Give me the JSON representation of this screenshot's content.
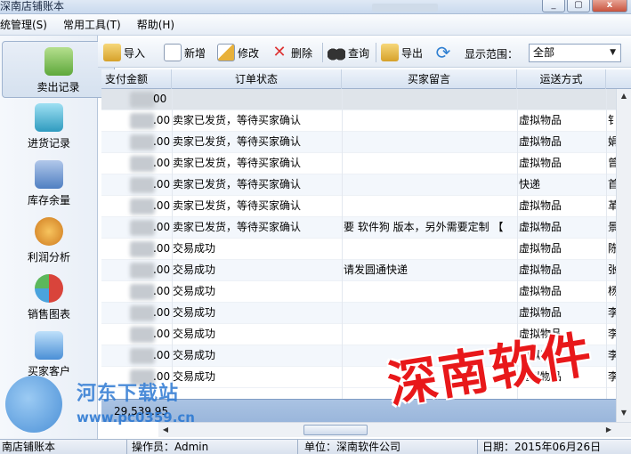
{
  "window": {
    "title": "深南店铺账本",
    "minimize_glyph": "_",
    "maximize_glyph": "▢",
    "close_glyph": "x"
  },
  "menu": [
    "统管理(S)",
    "常用工具(T)",
    "帮助(H)"
  ],
  "sidebar": {
    "items": [
      {
        "label": "卖出记录",
        "icon": "hand-money-icon",
        "color": "#6bb34a"
      },
      {
        "label": "进货记录",
        "icon": "basket-icon",
        "color": "#3aa6c9"
      },
      {
        "label": "库存余量",
        "icon": "warehouse-icon",
        "color": "#4f7fc2"
      },
      {
        "label": "利润分析",
        "icon": "money-bag-icon",
        "color": "#d98d2b"
      },
      {
        "label": "销售图表",
        "icon": "pie-chart-icon",
        "color": "#d9443b"
      },
      {
        "label": "买家客户",
        "icon": "contacts-icon",
        "color": "#4a8fd6"
      }
    ]
  },
  "toolbar": {
    "import_label": "导入",
    "new_label": "新增",
    "edit_label": "修改",
    "delete_label": "删除",
    "query_label": "查询",
    "export_label": "导出",
    "range_label": "显示范围：",
    "range_value": "全部"
  },
  "table": {
    "columns": [
      "支付金额",
      "订单状态",
      "买家留言",
      "运送方式"
    ],
    "rows": [
      {
        "amount": "00",
        "status": "",
        "message": "",
        "shipping": "",
        "extra": ""
      },
      {
        "amount": ".00",
        "status": "卖家已发货，等待买家确认",
        "message": "",
        "shipping": "虚拟物品",
        "extra": "钅"
      },
      {
        "amount": ".00",
        "status": "卖家已发货，等待买家确认",
        "message": "",
        "shipping": "虚拟物品",
        "extra": "娟"
      },
      {
        "amount": ".00",
        "status": "卖家已发货，等待买家确认",
        "message": "",
        "shipping": "虚拟物品",
        "extra": "曾"
      },
      {
        "amount": ".00",
        "status": "卖家已发货，等待买家确认",
        "message": "",
        "shipping": "快递",
        "extra": "首"
      },
      {
        "amount": ".00",
        "status": "卖家已发货，等待买家确认",
        "message": "",
        "shipping": "虚拟物品",
        "extra": "革"
      },
      {
        "amount": ".00",
        "status": "卖家已发货，等待买家确认",
        "message": "要 软件狗 版本，另外需要定制 【",
        "shipping": "虚拟物品",
        "extra": "景"
      },
      {
        "amount": ".00",
        "status": "交易成功",
        "message": "",
        "shipping": "虚拟物品",
        "extra": "陈"
      },
      {
        "amount": ".00",
        "status": "交易成功",
        "message": "请发圆通快递",
        "shipping": "虚拟物品",
        "extra": "张"
      },
      {
        "amount": ".00",
        "status": "交易成功",
        "message": "",
        "shipping": "虚拟物品",
        "extra": "杨"
      },
      {
        "amount": ".00",
        "status": "交易成功",
        "message": "",
        "shipping": "虚拟物品",
        "extra": "李"
      },
      {
        "amount": ".00",
        "status": "交易成功",
        "message": "",
        "shipping": "虚拟物品",
        "extra": "李"
      },
      {
        "amount": ".00",
        "status": "交易成功",
        "message": "",
        "shipping": "虚拟物品",
        "extra": "李"
      },
      {
        "amount": ".00",
        "status": "交易成功",
        "message": "",
        "shipping": "虚拟物品",
        "extra": "李"
      }
    ],
    "total": "29,539.95"
  },
  "statusbar": {
    "app": "南店铺账本",
    "operator": "操作员：Admin",
    "unit": "单位：深南软件公司",
    "date": "日期：2015年06月26日"
  },
  "watermarks": {
    "site_name": "河东下载站",
    "site_url": "www.pc0359.cn",
    "brand": "深南软件"
  },
  "colors": {
    "brand_red": "#e8181a",
    "watermark_blue": "#2e7ad3",
    "header_blue": "#d6e2f1"
  }
}
